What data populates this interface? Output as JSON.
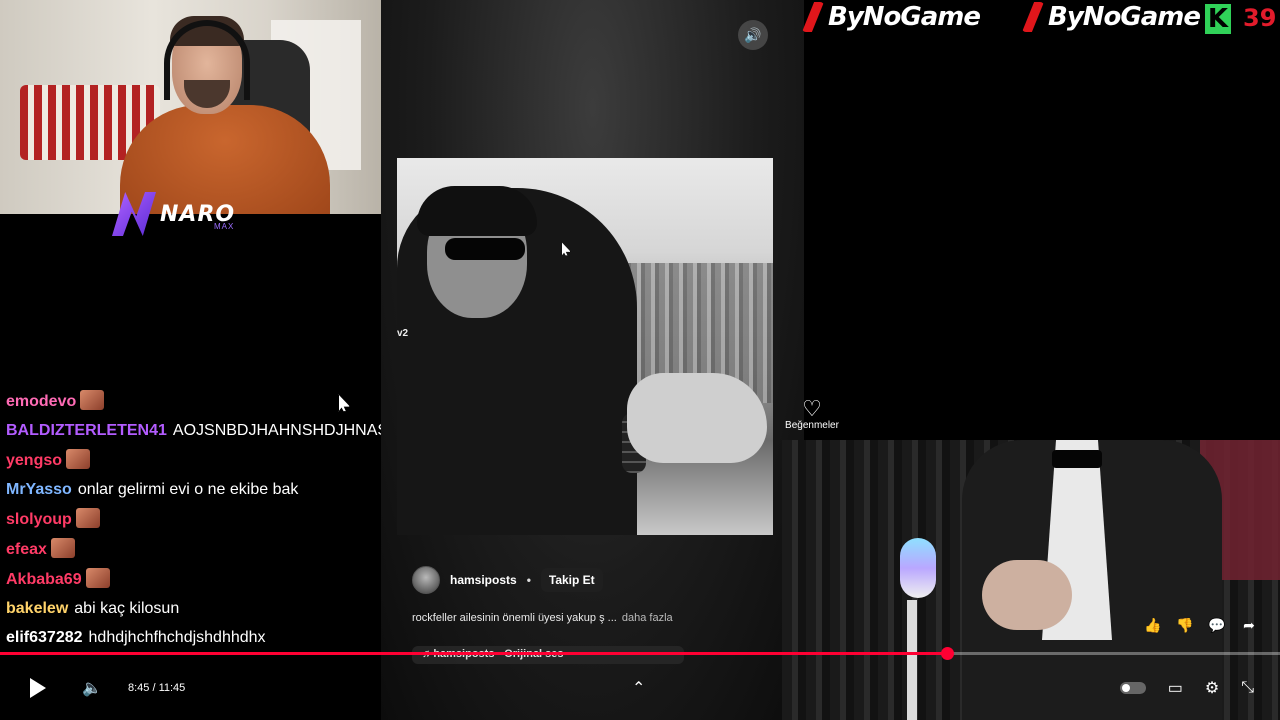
{
  "overlay": {
    "logo_text": "NARO",
    "logo_sub": "MAX",
    "sponsor_1": "ByNoGame",
    "sponsor_2": "ByNoGame",
    "kick_badge": "K",
    "kick_count": "39"
  },
  "chat": {
    "messages": [
      {
        "user": "emodevo",
        "color": "#ff6bb5",
        "text": "",
        "emote": true
      },
      {
        "user": "BALDIZTERLETEN41",
        "color": "#b35cff",
        "text": "AOJSNBDJHAHNSHDJHNASOJDNASD",
        "emote": false
      },
      {
        "user": "yengso",
        "color": "#ff3b66",
        "text": "",
        "emote": true
      },
      {
        "user": "MrYasso",
        "color": "#7fb6ff",
        "text": "onlar gelirmi evi o ne ekibe bak",
        "emote": false
      },
      {
        "user": "slolyoup",
        "color": "#ff3b66",
        "text": "",
        "emote": true
      },
      {
        "user": "efeax",
        "color": "#ff3b66",
        "text": "",
        "emote": true
      },
      {
        "user": "Akbaba69",
        "color": "#ff3b66",
        "text": "",
        "emote": true
      },
      {
        "user": "bakelew",
        "color": "#ffd36a",
        "text": "abi kaç kilosun",
        "emote": false
      },
      {
        "user": "elif637282",
        "color": "#ffffff",
        "text": "hdhdjhchfhchdjshdhhdhx",
        "emote": false
      }
    ]
  },
  "reel": {
    "watermark": "v2",
    "author": "hamsiposts",
    "separator": "•",
    "follow_label": "Takip Et",
    "caption": "rockfeller ailesinin önemli üyesi yakup ş ...",
    "more_label": "daha fazla",
    "audio": "hamsiposts · Orijinal ses",
    "like_label": "Beğenmeler",
    "mute_icon": "speaker-icon"
  },
  "player": {
    "time": "8:45 / 11:45",
    "progress": 0.74
  },
  "colors": {
    "progress": "#ff0033",
    "sponsor_bolt": "#e0161b",
    "kick_green": "#30d158",
    "kick_count": "#e21b2b"
  }
}
